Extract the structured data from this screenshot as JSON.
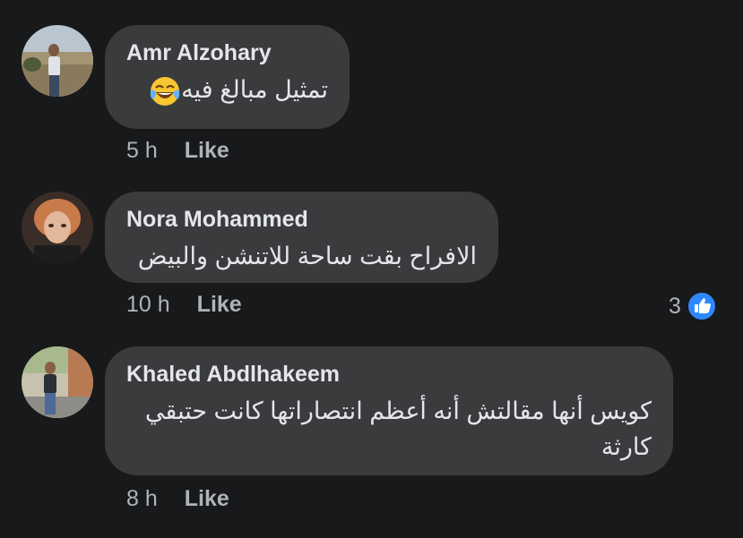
{
  "comments": [
    {
      "author": "Amr Alzohary",
      "text": "تمثيل مبالغ فيه",
      "emoji": "face-with-tears-of-joy",
      "time": "5 h",
      "like_label": "Like"
    },
    {
      "author": "Nora Mohammed",
      "text": "الافراح بقت ساحة للاتنشن والبيض",
      "time": "10 h",
      "like_label": "Like",
      "reaction_count": "3"
    },
    {
      "author": "Khaled Abdlhakeem",
      "text_line1": "كويس أنها مقالتش أنه أعظم انتصاراتها كانت حتبقي",
      "text_line2": "كارثة",
      "time": "8 h",
      "like_label": "Like"
    }
  ],
  "colors": {
    "background": "#18191a",
    "bubble": "#3a3b3c",
    "primary_text": "#e4e6eb",
    "secondary_text": "#b0b3b8",
    "like_blue": "#2d88ff"
  }
}
